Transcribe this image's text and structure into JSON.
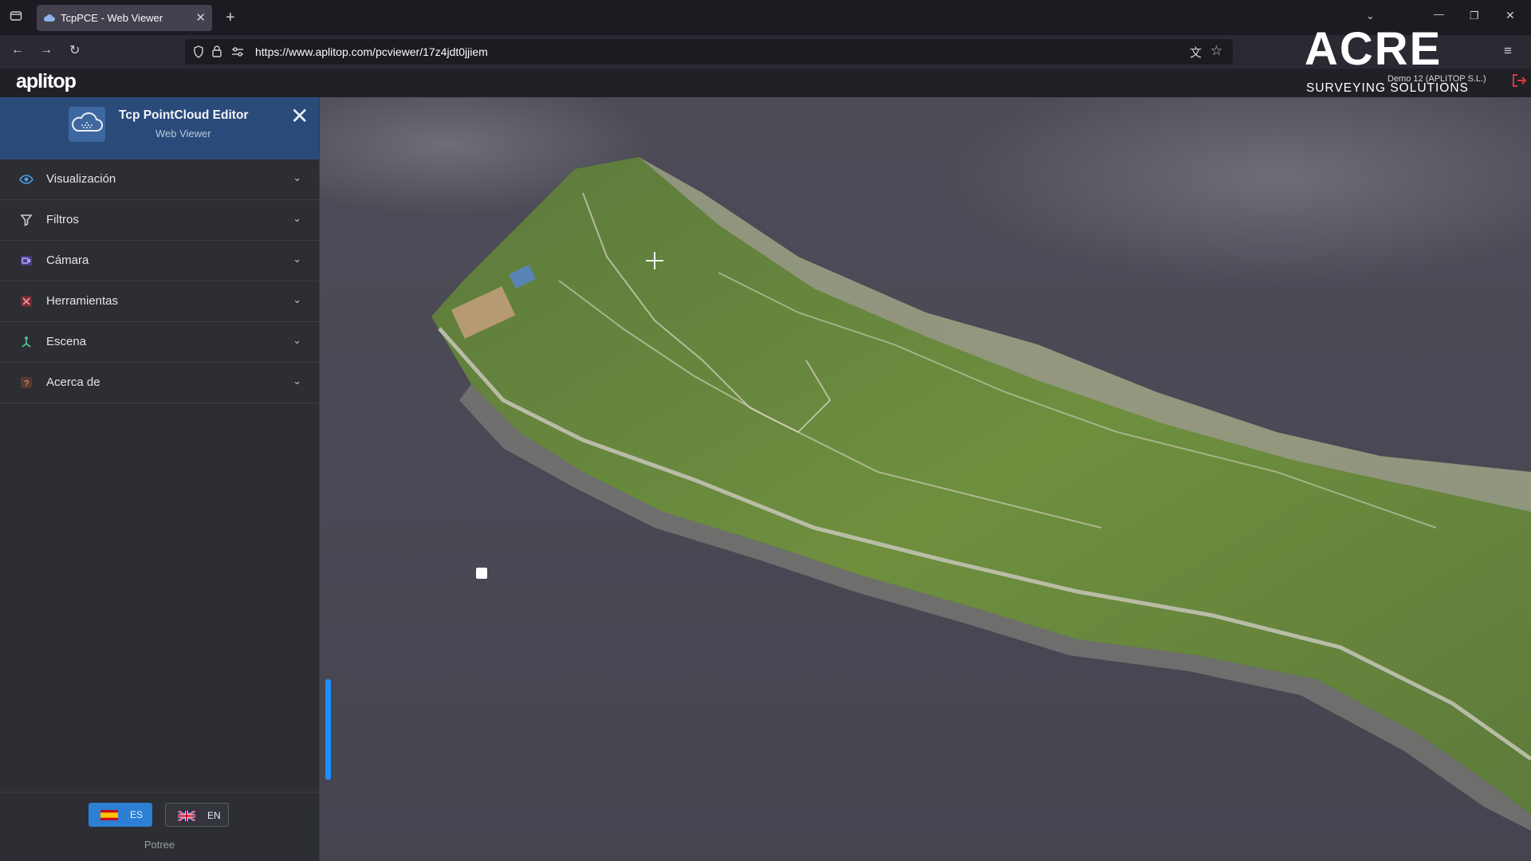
{
  "browser": {
    "tab_title": "TcpPCE - Web Viewer",
    "url": "https://www.aplitop.com/pcviewer/17z4jdt0jjiem"
  },
  "app": {
    "brand": "aplitop",
    "user": "Demo 12 (APLITOP S.L.)",
    "watermark": {
      "word": "ACRE",
      "subtitle": "SURVEYING SOLUTIONS"
    }
  },
  "sidebar": {
    "title": "Tcp PointCloud Editor",
    "subtitle": "Web Viewer",
    "items": [
      {
        "label": "Visualización",
        "icon": "eye-icon",
        "color": "#4a9fe8"
      },
      {
        "label": "Filtros",
        "icon": "filter-icon",
        "color": "#c9cbd0"
      },
      {
        "label": "Cámara",
        "icon": "camera-icon",
        "color": "#8e7fe0"
      },
      {
        "label": "Herramientas",
        "icon": "tools-icon",
        "color": "#e0505a"
      },
      {
        "label": "Escena",
        "icon": "scene-icon",
        "color": "#4bc08a"
      },
      {
        "label": "Acerca de",
        "icon": "help-icon",
        "color": "#e07050"
      }
    ],
    "languages": [
      {
        "code": "ES",
        "active": true
      },
      {
        "code": "EN",
        "active": false
      }
    ],
    "footer": "Potree"
  },
  "colors": {
    "accent": "#2d7fd3",
    "header": "#2a4a7a",
    "sidebar_bg": "#2c2e33"
  }
}
